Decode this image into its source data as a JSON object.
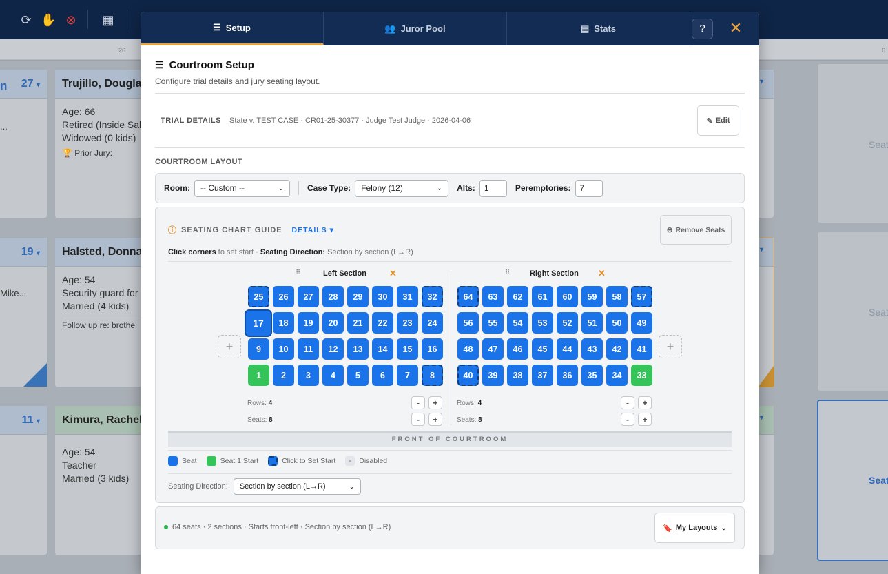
{
  "background": {
    "ruler_ticks": [
      "26",
      "6"
    ],
    "cards": [
      {
        "number": "27",
        "name": "Trujillo, Douglas",
        "lines": [
          "Age: 66",
          "Retired (Inside Sal",
          "Widowed (0 kids)"
        ],
        "note": "Prior Jury:",
        "left_text": "n",
        "left_sub": "..."
      },
      {
        "number": "19",
        "name": "Halsted, Donna",
        "lines": [
          "Age: 54",
          "Security guard for",
          "Married (4 kids)"
        ],
        "note": "Follow up re: brothe",
        "left_sub": "Mike..."
      },
      {
        "number": "11",
        "name": "Kimura, Rachel",
        "lines": [
          "Age: 54",
          "Teacher",
          "Married (3 kids)"
        ],
        "note": ""
      }
    ],
    "right_seat_labels": [
      "Seat",
      "Seat",
      "Seat"
    ]
  },
  "tabs": [
    {
      "label": "Setup",
      "icon": "sliders-icon",
      "active": true
    },
    {
      "label": "Juror Pool",
      "icon": "users-icon",
      "active": false
    },
    {
      "label": "Stats",
      "icon": "chart-icon",
      "active": false
    }
  ],
  "header": {
    "help_glyph": "?",
    "close_glyph": "✕"
  },
  "setup": {
    "title": "Courtroom Setup",
    "subtitle": "Configure trial details and jury seating layout.",
    "trial_label": "TRIAL DETAILS",
    "trial_value": "State v. TEST CASE · CR01-25-30377 · Judge Test Judge · 2026-04-06",
    "edit_label": "Edit",
    "layout_label": "COURTROOM LAYOUT"
  },
  "room_bar": {
    "room_label": "Room:",
    "room_value": "-- Custom --",
    "case_type_label": "Case Type:",
    "case_type_value": "Felony (12)",
    "alts_label": "Alts:",
    "alts_value": "1",
    "peremptories_label": "Peremptories:",
    "peremptories_value": "7"
  },
  "guide": {
    "title": "SEATING CHART GUIDE",
    "details_label": "DETAILS ▾",
    "remove_seats_label": "Remove Seats",
    "click_bold": "Click corners",
    "click_text": " to set start · ",
    "direction_bold": "Seating Direction:",
    "direction_text": " Section by section (L→R)"
  },
  "sections": [
    {
      "name": "Left Section",
      "rows": [
        [
          "25",
          "26",
          "27",
          "28",
          "29",
          "30",
          "31",
          "32"
        ],
        [
          "17",
          "18",
          "19",
          "20",
          "21",
          "22",
          "23",
          "24"
        ],
        [
          "9",
          "10",
          "11",
          "12",
          "13",
          "14",
          "15",
          "16"
        ],
        [
          "1",
          "2",
          "3",
          "4",
          "5",
          "6",
          "7",
          "8"
        ]
      ],
      "rows_label": "Rows:",
      "rows_value": "4",
      "seats_label": "Seats:",
      "seats_value": "8"
    },
    {
      "name": "Right Section",
      "rows": [
        [
          "64",
          "63",
          "62",
          "61",
          "60",
          "59",
          "58",
          "57"
        ],
        [
          "56",
          "55",
          "54",
          "53",
          "52",
          "51",
          "50",
          "49"
        ],
        [
          "48",
          "47",
          "46",
          "45",
          "44",
          "43",
          "42",
          "41"
        ],
        [
          "40",
          "39",
          "38",
          "37",
          "36",
          "35",
          "34",
          "33"
        ]
      ],
      "rows_label": "Rows:",
      "rows_value": "4",
      "seats_label": "Seats:",
      "seats_value": "8"
    }
  ],
  "front_label": "FRONT OF COURTROOM",
  "legend": [
    {
      "label": "Seat",
      "color": "#1a73e8"
    },
    {
      "label": "Seat 1 Start",
      "color": "#34c45a"
    },
    {
      "label": "Click to Set Start",
      "color": "#1a73e8"
    },
    {
      "label": "Disabled",
      "color": "#e2e5e9"
    }
  ],
  "direction": {
    "label": "Seating Direction:",
    "value": "Section by section (L→R)"
  },
  "summary": {
    "text": "64 seats · 2 sections · Starts front-left · Section by section (L→R)",
    "my_layouts_label": "My Layouts"
  },
  "colors": {
    "seat": "#1a73e8",
    "start": "#34c45a",
    "accent": "#f0a030",
    "nav": "#132c54"
  }
}
